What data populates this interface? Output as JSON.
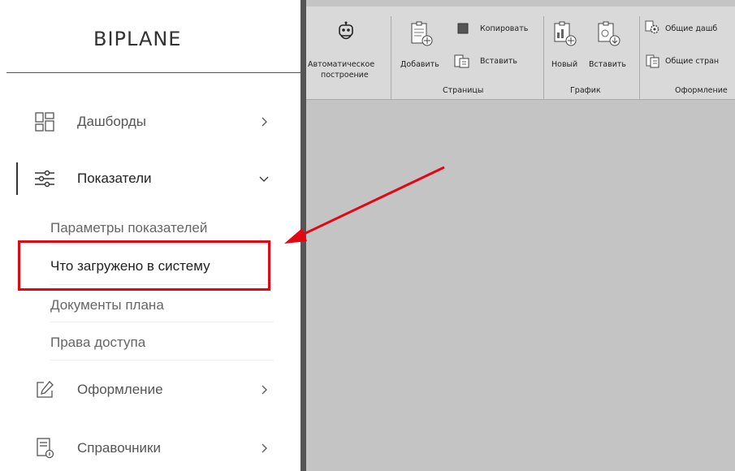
{
  "logo": "BIPLANE",
  "nav": {
    "dashboards": "Дашборды",
    "indicators": "Показатели",
    "design": "Оформление",
    "references": "Справочники"
  },
  "submenu": [
    "Параметры показателей",
    "Что загружено в систему",
    "Документы плана",
    "Права доступа"
  ],
  "ribbon": {
    "auto_build_line1": "Автоматическое",
    "auto_build_line2": "построение",
    "add": "Добавить",
    "copy": "Копировать",
    "paste": "Вставить",
    "pages_group": "Страницы",
    "new": "Новый",
    "paste_chart": "Вставить",
    "chart_group": "График",
    "common_dash": "Общие дашб",
    "common_pages": "Общие стран",
    "design_group": "Оформление"
  },
  "colors": {
    "highlight": "#e30613",
    "arrow": "#e30613",
    "workspace": "#c4c4c4",
    "ribbon": "#d9d9d9"
  }
}
